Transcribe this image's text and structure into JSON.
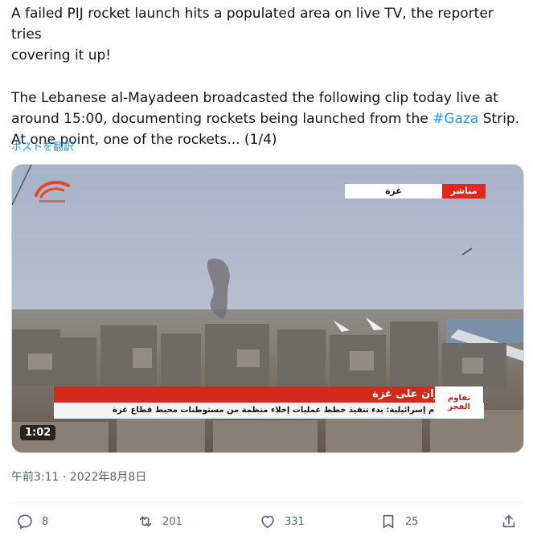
{
  "tweet": {
    "text_line1": "A failed PIJ rocket launch hits a populated area on live TV, the reporter tries",
    "text_line2": "covering it up!",
    "text_line3": "The Lebanese al-Mayadeen broadcasted the following clip today live at",
    "text_line4_prefix": "around 15:00, documenting rockets being launched from the ",
    "hashtag": "#Gaza",
    "text_line4_suffix": " Strip.",
    "text_line5": "At one point, one of the rockets... (1/4)",
    "translate_label": "ポストを翻訳",
    "timestamp": "午前3:11 · 2022年8月8日"
  },
  "video": {
    "duration": "1:02",
    "live_label": "مباشر",
    "live_place": "غزة",
    "headline": "العدوان على غزة",
    "subline": "وسائل إعلام إسرائيلية: بدء تنفيذ خطط عمليات إخلاء منظمة من مستوطنات محيط قطاع غزة",
    "program_line1": "تقاوم",
    "program_line2": "الفجر"
  },
  "actions": {
    "reply_count": "8",
    "retweet_count": "201",
    "like_count": "331",
    "bookmark_count": "25"
  },
  "icons": {
    "reply": "reply-icon",
    "retweet": "retweet-icon",
    "like": "heart-icon",
    "bookmark": "bookmark-icon",
    "share": "share-icon"
  },
  "colors": {
    "accent": "#1d9bf0",
    "text": "#0f1419",
    "muted": "#536471",
    "ticker_red": "#d42a1e"
  }
}
